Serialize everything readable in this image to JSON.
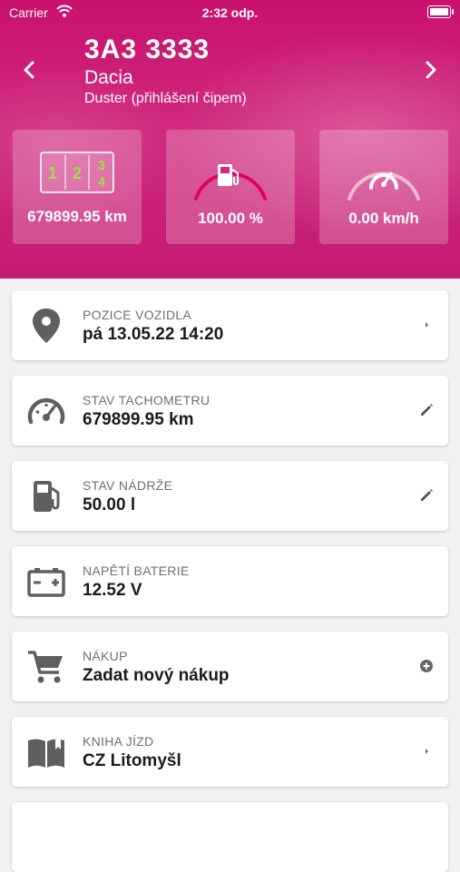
{
  "status_bar": {
    "carrier": "Carrier",
    "time": "2:32 odp."
  },
  "vehicle": {
    "plate": "3A3 3333",
    "make": "Dacia",
    "model": "Duster (přihlášení čipem)"
  },
  "gear_display": {
    "digits": [
      "1",
      "2",
      "3",
      "4"
    ]
  },
  "stats": {
    "odometer": "679899.95 km",
    "fuel": "100.00 %",
    "speed": "0.00 km/h"
  },
  "gauges": {
    "fuel_level": 1.0,
    "speed_level": 0.0
  },
  "colors": {
    "brand": "#c8126e",
    "gear_digits": "#9be24a",
    "icon_gray": "#5f5f5f"
  },
  "cards": [
    {
      "label": "POZICE VOZIDLA",
      "value": "pá 13.05.22 14:20",
      "icon": "location-pin-icon",
      "action": "chevron-right-icon"
    },
    {
      "label": "STAV TACHOMETRU",
      "value": "679899.95 km",
      "icon": "speedometer-icon",
      "action": "pencil-icon"
    },
    {
      "label": "STAV NÁDRŽE",
      "value": "50.00 l",
      "icon": "fuel-pump-icon",
      "action": "pencil-icon"
    },
    {
      "label": "NAPĚTÍ BATERIE",
      "value": "12.52 V",
      "icon": "battery-icon",
      "action": ""
    },
    {
      "label": "NÁKUP",
      "value": "Zadat nový nákup",
      "icon": "shopping-cart-icon",
      "action": "add-circle-icon"
    },
    {
      "label": "KNIHA JÍZD",
      "value": "CZ Litomyšl",
      "icon": "book-icon",
      "action": "chevron-right-icon"
    }
  ]
}
